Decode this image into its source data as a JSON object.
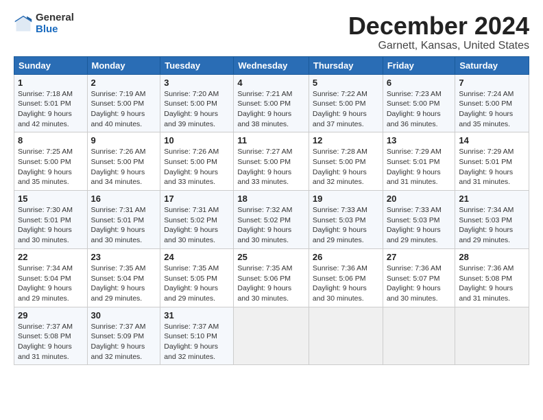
{
  "logo": {
    "general": "General",
    "blue": "Blue"
  },
  "title": "December 2024",
  "subtitle": "Garnett, Kansas, United States",
  "days_header": [
    "Sunday",
    "Monday",
    "Tuesday",
    "Wednesday",
    "Thursday",
    "Friday",
    "Saturday"
  ],
  "weeks": [
    [
      {
        "day": "1",
        "info": "Sunrise: 7:18 AM\nSunset: 5:01 PM\nDaylight: 9 hours\nand 42 minutes."
      },
      {
        "day": "2",
        "info": "Sunrise: 7:19 AM\nSunset: 5:00 PM\nDaylight: 9 hours\nand 40 minutes."
      },
      {
        "day": "3",
        "info": "Sunrise: 7:20 AM\nSunset: 5:00 PM\nDaylight: 9 hours\nand 39 minutes."
      },
      {
        "day": "4",
        "info": "Sunrise: 7:21 AM\nSunset: 5:00 PM\nDaylight: 9 hours\nand 38 minutes."
      },
      {
        "day": "5",
        "info": "Sunrise: 7:22 AM\nSunset: 5:00 PM\nDaylight: 9 hours\nand 37 minutes."
      },
      {
        "day": "6",
        "info": "Sunrise: 7:23 AM\nSunset: 5:00 PM\nDaylight: 9 hours\nand 36 minutes."
      },
      {
        "day": "7",
        "info": "Sunrise: 7:24 AM\nSunset: 5:00 PM\nDaylight: 9 hours\nand 35 minutes."
      }
    ],
    [
      {
        "day": "8",
        "info": "Sunrise: 7:25 AM\nSunset: 5:00 PM\nDaylight: 9 hours\nand 35 minutes."
      },
      {
        "day": "9",
        "info": "Sunrise: 7:26 AM\nSunset: 5:00 PM\nDaylight: 9 hours\nand 34 minutes."
      },
      {
        "day": "10",
        "info": "Sunrise: 7:26 AM\nSunset: 5:00 PM\nDaylight: 9 hours\nand 33 minutes."
      },
      {
        "day": "11",
        "info": "Sunrise: 7:27 AM\nSunset: 5:00 PM\nDaylight: 9 hours\nand 33 minutes."
      },
      {
        "day": "12",
        "info": "Sunrise: 7:28 AM\nSunset: 5:00 PM\nDaylight: 9 hours\nand 32 minutes."
      },
      {
        "day": "13",
        "info": "Sunrise: 7:29 AM\nSunset: 5:01 PM\nDaylight: 9 hours\nand 31 minutes."
      },
      {
        "day": "14",
        "info": "Sunrise: 7:29 AM\nSunset: 5:01 PM\nDaylight: 9 hours\nand 31 minutes."
      }
    ],
    [
      {
        "day": "15",
        "info": "Sunrise: 7:30 AM\nSunset: 5:01 PM\nDaylight: 9 hours\nand 30 minutes."
      },
      {
        "day": "16",
        "info": "Sunrise: 7:31 AM\nSunset: 5:01 PM\nDaylight: 9 hours\nand 30 minutes."
      },
      {
        "day": "17",
        "info": "Sunrise: 7:31 AM\nSunset: 5:02 PM\nDaylight: 9 hours\nand 30 minutes."
      },
      {
        "day": "18",
        "info": "Sunrise: 7:32 AM\nSunset: 5:02 PM\nDaylight: 9 hours\nand 30 minutes."
      },
      {
        "day": "19",
        "info": "Sunrise: 7:33 AM\nSunset: 5:03 PM\nDaylight: 9 hours\nand 29 minutes."
      },
      {
        "day": "20",
        "info": "Sunrise: 7:33 AM\nSunset: 5:03 PM\nDaylight: 9 hours\nand 29 minutes."
      },
      {
        "day": "21",
        "info": "Sunrise: 7:34 AM\nSunset: 5:03 PM\nDaylight: 9 hours\nand 29 minutes."
      }
    ],
    [
      {
        "day": "22",
        "info": "Sunrise: 7:34 AM\nSunset: 5:04 PM\nDaylight: 9 hours\nand 29 minutes."
      },
      {
        "day": "23",
        "info": "Sunrise: 7:35 AM\nSunset: 5:04 PM\nDaylight: 9 hours\nand 29 minutes."
      },
      {
        "day": "24",
        "info": "Sunrise: 7:35 AM\nSunset: 5:05 PM\nDaylight: 9 hours\nand 29 minutes."
      },
      {
        "day": "25",
        "info": "Sunrise: 7:35 AM\nSunset: 5:06 PM\nDaylight: 9 hours\nand 30 minutes."
      },
      {
        "day": "26",
        "info": "Sunrise: 7:36 AM\nSunset: 5:06 PM\nDaylight: 9 hours\nand 30 minutes."
      },
      {
        "day": "27",
        "info": "Sunrise: 7:36 AM\nSunset: 5:07 PM\nDaylight: 9 hours\nand 30 minutes."
      },
      {
        "day": "28",
        "info": "Sunrise: 7:36 AM\nSunset: 5:08 PM\nDaylight: 9 hours\nand 31 minutes."
      }
    ],
    [
      {
        "day": "29",
        "info": "Sunrise: 7:37 AM\nSunset: 5:08 PM\nDaylight: 9 hours\nand 31 minutes."
      },
      {
        "day": "30",
        "info": "Sunrise: 7:37 AM\nSunset: 5:09 PM\nDaylight: 9 hours\nand 32 minutes."
      },
      {
        "day": "31",
        "info": "Sunrise: 7:37 AM\nSunset: 5:10 PM\nDaylight: 9 hours\nand 32 minutes."
      },
      null,
      null,
      null,
      null
    ]
  ]
}
